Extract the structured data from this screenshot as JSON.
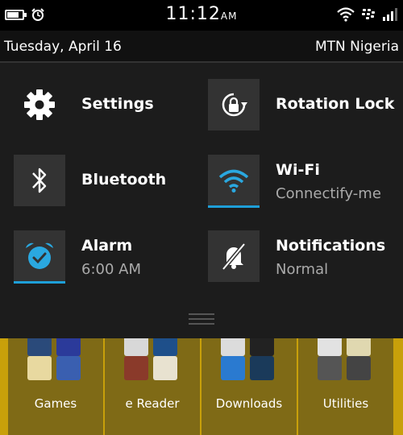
{
  "status_bar": {
    "time": "11:12",
    "ampm": "AM",
    "battery_level": 0.75,
    "icons": [
      "battery-icon",
      "alarm-clock-icon",
      "wifi-icon",
      "blackberry-logo-icon",
      "signal-icon"
    ]
  },
  "info_bar": {
    "date": "Tuesday, April 16",
    "carrier": "MTN Nigeria"
  },
  "tiles": [
    {
      "label": "Settings",
      "sub": "",
      "icon": "gear-icon"
    },
    {
      "label": "Rotation Lock",
      "sub": "",
      "icon": "rotation-lock-icon"
    },
    {
      "label": "Bluetooth",
      "sub": "",
      "icon": "bluetooth-icon"
    },
    {
      "label": "Wi-Fi",
      "sub": "Connectify-me",
      "icon": "wifi-icon",
      "active": true
    },
    {
      "label": "Alarm",
      "sub": "6:00 AM",
      "icon": "alarm-icon",
      "active": true
    },
    {
      "label": "Notifications",
      "sub": "Normal",
      "icon": "bell-muted-icon"
    }
  ],
  "home_folders": [
    {
      "label": "Games"
    },
    {
      "label": "e Reader"
    },
    {
      "label": "Downloads"
    },
    {
      "label": "Utilities"
    }
  ],
  "colors": {
    "accent": "#1e9fd8",
    "panel": "#1c1c1c",
    "home_background": "#c8a00a"
  }
}
